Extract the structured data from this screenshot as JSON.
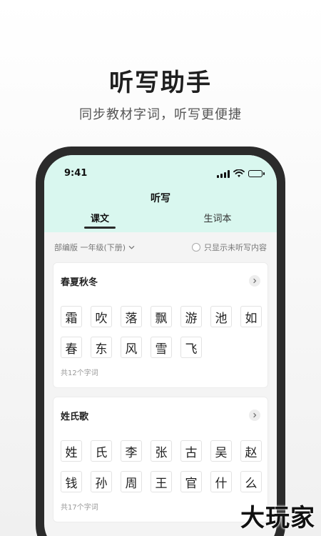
{
  "hero": {
    "title": "听写助手",
    "subtitle": "同步教材字词，听写更便捷"
  },
  "status_bar": {
    "time": "9:41"
  },
  "nav": {
    "title": "听写"
  },
  "tabs": [
    {
      "label": "课文",
      "active": true
    },
    {
      "label": "生词本",
      "active": false
    }
  ],
  "filter": {
    "textbook": "部编版 一年级(下册)",
    "only_unheard_label": "只显示未听写内容"
  },
  "lessons": [
    {
      "title": "春夏秋冬",
      "chars": [
        "霜",
        "吹",
        "落",
        "飘",
        "游",
        "池",
        "如",
        "春",
        "东",
        "风",
        "雪",
        "飞"
      ],
      "count_text": "共12个字词"
    },
    {
      "title": "姓氏歌",
      "chars": [
        "姓",
        "氏",
        "李",
        "张",
        "古",
        "吴",
        "赵",
        "钱",
        "孙",
        "周",
        "王",
        "官",
        "什",
        "么"
      ],
      "count_text": "共17个字词"
    }
  ],
  "watermark": "大玩家",
  "colors": {
    "header_bg": "#d9f7ef",
    "accent": "#2a2a2a"
  }
}
